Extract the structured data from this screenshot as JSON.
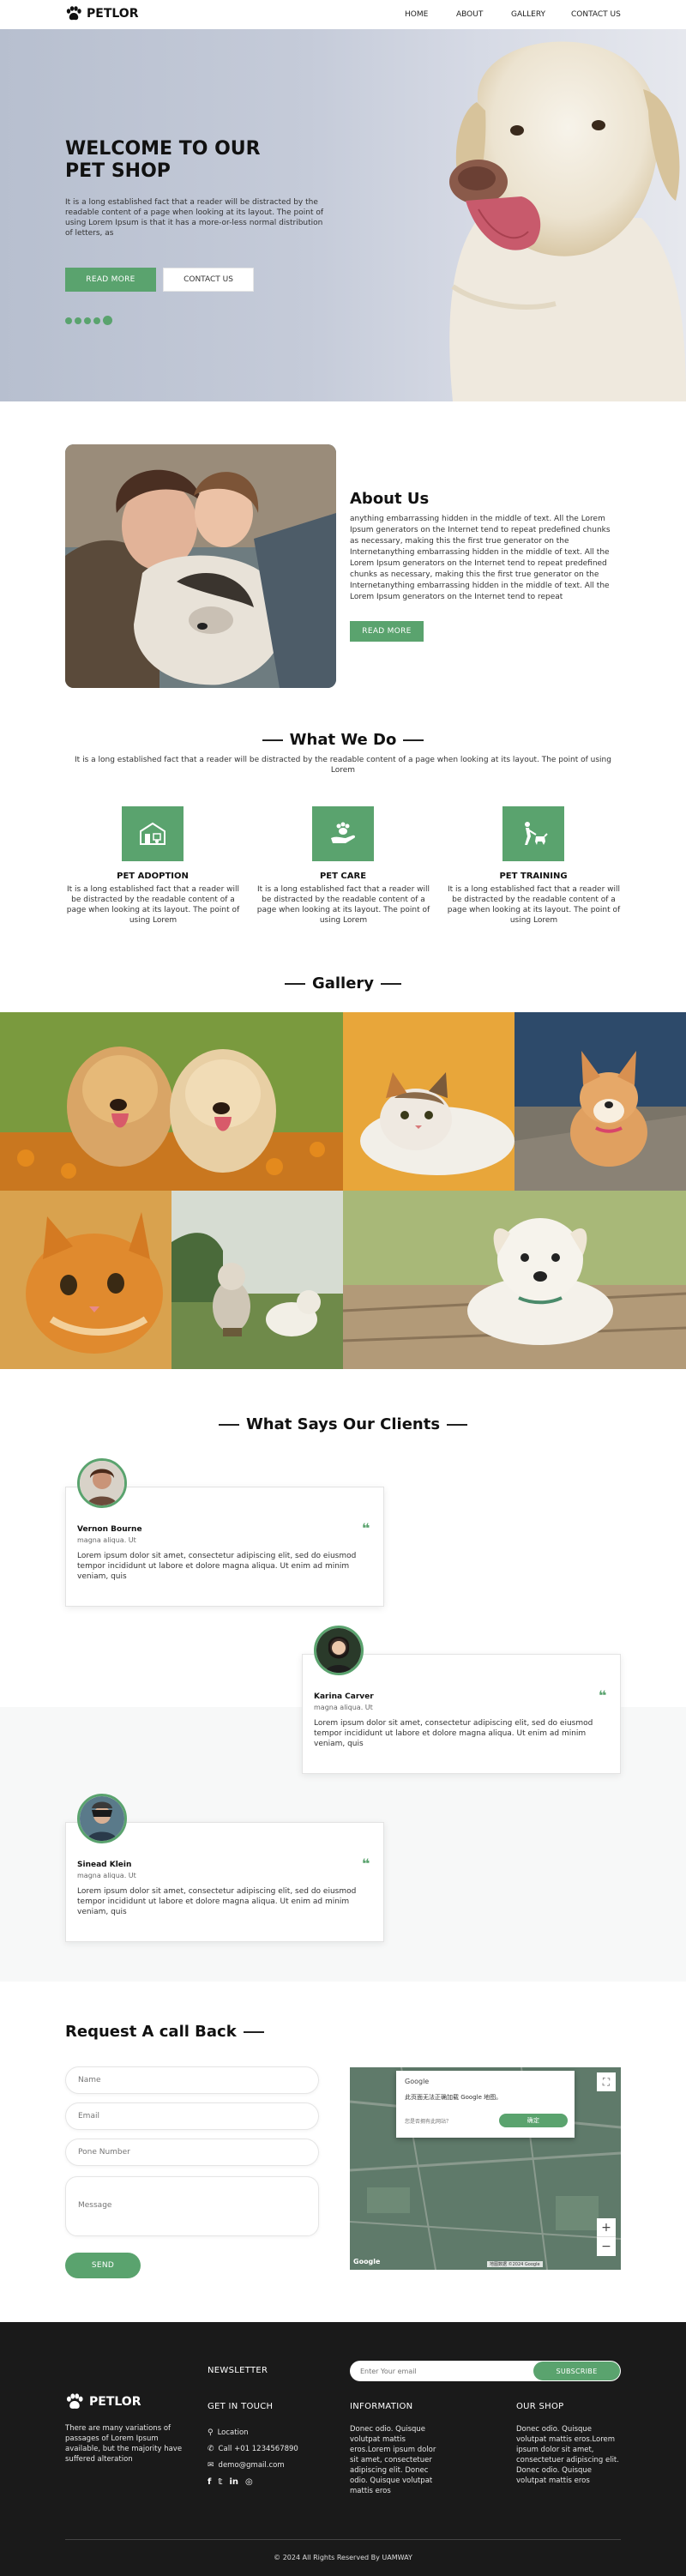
{
  "brand": {
    "name": "PETLOR",
    "green": "#5aa36e",
    "dark": "#1a1a1a"
  },
  "nav": {
    "items": [
      "HOME",
      "ABOUT",
      "GALLERY",
      "CONTACT US"
    ]
  },
  "hero": {
    "title_line1": "WELCOME TO OUR",
    "title_line2": "PET SHOP",
    "text": "It is a long established fact that a reader will be distracted by the readable content of a page when looking at its layout. The point of using Lorem Ipsum is that it has a more-or-less normal distribution of letters, as",
    "btn_primary": "READ MORE",
    "btn_secondary": "CONTACT US"
  },
  "about": {
    "title": "About Us",
    "text": "anything embarrassing hidden in the middle of text. All the Lorem Ipsum generators on the Internet tend to repeat predefined chunks as necessary, making this the first true generator on the Internetanything embarrassing hidden in the middle of text. All the Lorem Ipsum generators on the Internet tend to repeat predefined chunks as necessary, making this the first true generator on the Internetanything embarrassing hidden in the middle of text. All the Lorem Ipsum generators on the Internet tend to repeat",
    "btn": "READ MORE"
  },
  "services": {
    "title": "What We Do",
    "subtitle": "It is a long established fact that a reader will be distracted by the readable content of a page when looking at its layout. The point of using Lorem",
    "items": [
      {
        "title": "PET ADOPTION",
        "icon": "pet-house-icon",
        "text": "It is a long established fact that a reader will be distracted by the readable content of a page when looking at its layout. The point of using Lorem"
      },
      {
        "title": "PET CARE",
        "icon": "hand-paw-icon",
        "text": "It is a long established fact that a reader will be distracted by the readable content of a page when looking at its layout. The point of using Lorem"
      },
      {
        "title": "PET TRAINING",
        "icon": "dog-training-icon",
        "text": "It is a long established fact that a reader will be distracted by the readable content of a page when looking at its layout. The point of using Lorem"
      }
    ]
  },
  "gallery": {
    "title": "Gallery"
  },
  "testimonials": {
    "title": "What Says Our Clients",
    "items": [
      {
        "name": "Vernon Bourne",
        "role": "magna aliqua. Ut",
        "text": "Lorem ipsum dolor sit amet, consectetur adipiscing elit, sed do eiusmod tempor incididunt ut labore et dolore magna aliqua. Ut enim ad minim veniam, quis",
        "quote": "❝"
      },
      {
        "name": "Karina Carver",
        "role": "magna aliqua. Ut",
        "text": "Lorem ipsum dolor sit amet, consectetur adipiscing elit, sed do eiusmod tempor incididunt ut labore et dolore magna aliqua. Ut enim ad minim veniam, quis",
        "quote": "❝"
      },
      {
        "name": "Sinead Klein",
        "role": "magna aliqua. Ut",
        "text": "Lorem ipsum dolor sit amet, consectetur adipiscing elit, sed do eiusmod tempor incididunt ut labore et dolore magna aliqua. Ut enim ad minim veniam, quis",
        "quote": "❝"
      }
    ]
  },
  "callback": {
    "title": "Request A call Back",
    "name_placeholder": "Name",
    "email_placeholder": "Email",
    "phone_placeholder": "Pone Number",
    "message_placeholder": "Message",
    "send": "SEND"
  },
  "map": {
    "popup_brand": "Google",
    "popup_text": "此页面无法正确加载 Google 地图。",
    "popup_question": "您是否拥有此网站？",
    "popup_btn": "确定",
    "attribution": "地图数据 ©2024 Google",
    "zoom_in": "+",
    "zoom_out": "−"
  },
  "footer": {
    "brand": "PETLOR",
    "about": "There are many variations of passages of Lorem Ipsum available, but the majority have suffered alteration",
    "newsletter_title": "NEWSLETTER",
    "newsletter_placeholder": "Enter Your email",
    "subscribe": "SUBSCRIBE",
    "touch_title": "GET IN TOUCH",
    "location": "Location",
    "call": "Call +01 1234567890",
    "email": "demo@gmail.com",
    "info_title": "INFORMATION",
    "info_text": "Donec odio. Quisque volutpat mattis eros.Lorem ipsum dolor sit amet, consectetuer adipiscing elit. Donec odio. Quisque volutpat mattis eros",
    "shop_title": "OUR SHOP",
    "shop_text": "Donec odio. Quisque volutpat mattis eros.Lorem ipsum dolor sit amet, consectetuer adipiscing elit. Donec odio. Quisque volutpat mattis eros",
    "copyright": "© 2024 All Rights Reserved By UAMWAY"
  }
}
